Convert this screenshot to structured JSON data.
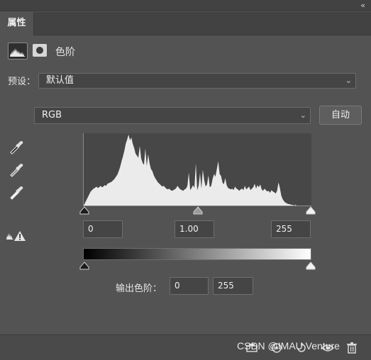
{
  "panel": {
    "tab_label": "属性",
    "collapse_glyph": "‹‹",
    "adjustment_title": "色阶"
  },
  "preset": {
    "label": "预设：",
    "value": "默认值"
  },
  "channel": {
    "value": "RGB"
  },
  "auto_button_label": "自动",
  "input_levels": {
    "black": "0",
    "gamma": "1.00",
    "white": "255"
  },
  "output_levels": {
    "label": "输出色阶：",
    "black": "0",
    "white": "255"
  },
  "watermark": "CSDN @IMAU Venture",
  "icons": {
    "levels": "histogram-icon",
    "mask": "layer-mask-icon",
    "droppers": [
      "black-point-eyedropper-icon",
      "gray-point-eyedropper-icon",
      "white-point-eyedropper-icon"
    ],
    "clipping": "clipping-warning-icon",
    "bottom": [
      "clip-to-layer-icon",
      "view-previous-state-icon",
      "reset-icon",
      "visibility-eye-icon",
      "trash-icon"
    ]
  },
  "histogram_shape": [
    0,
    4,
    8,
    12,
    16,
    20,
    22,
    24,
    25,
    27,
    25,
    26,
    28,
    26,
    27,
    29,
    28,
    31,
    32,
    33,
    34,
    36,
    38,
    41,
    44,
    49,
    55,
    63,
    70,
    78,
    88,
    94,
    101,
    93,
    97,
    88,
    82,
    74,
    71,
    68,
    85,
    67,
    61,
    58,
    81,
    56,
    73,
    60,
    52,
    49,
    43,
    39,
    36,
    33,
    31,
    29,
    27,
    28,
    26,
    24,
    23,
    24,
    22,
    21,
    22,
    23,
    25,
    28,
    25,
    23,
    22,
    21,
    23,
    24,
    28,
    47,
    22,
    25,
    29,
    25,
    60,
    22,
    28,
    46,
    24,
    51,
    36,
    27,
    30,
    43,
    26,
    28,
    38,
    45,
    41,
    52,
    63,
    45,
    42,
    33,
    30,
    39,
    29,
    25,
    24,
    23,
    24,
    22,
    27,
    24,
    23,
    21,
    23,
    24,
    22,
    28,
    23,
    25,
    27,
    22,
    24,
    26,
    31,
    24,
    29,
    26,
    30,
    23,
    21,
    24,
    22,
    20,
    21,
    18,
    22,
    20,
    19,
    17,
    21,
    33,
    25,
    14,
    9,
    6,
    4,
    3,
    2,
    2,
    1,
    1,
    0,
    1,
    0,
    0,
    0,
    0,
    0,
    0,
    0,
    0,
    0,
    0,
    0,
    0
  ],
  "colors": {
    "panel_bg": "#535353",
    "histogram_fill": "#ebebeb",
    "histogram_bg": "#474747"
  }
}
